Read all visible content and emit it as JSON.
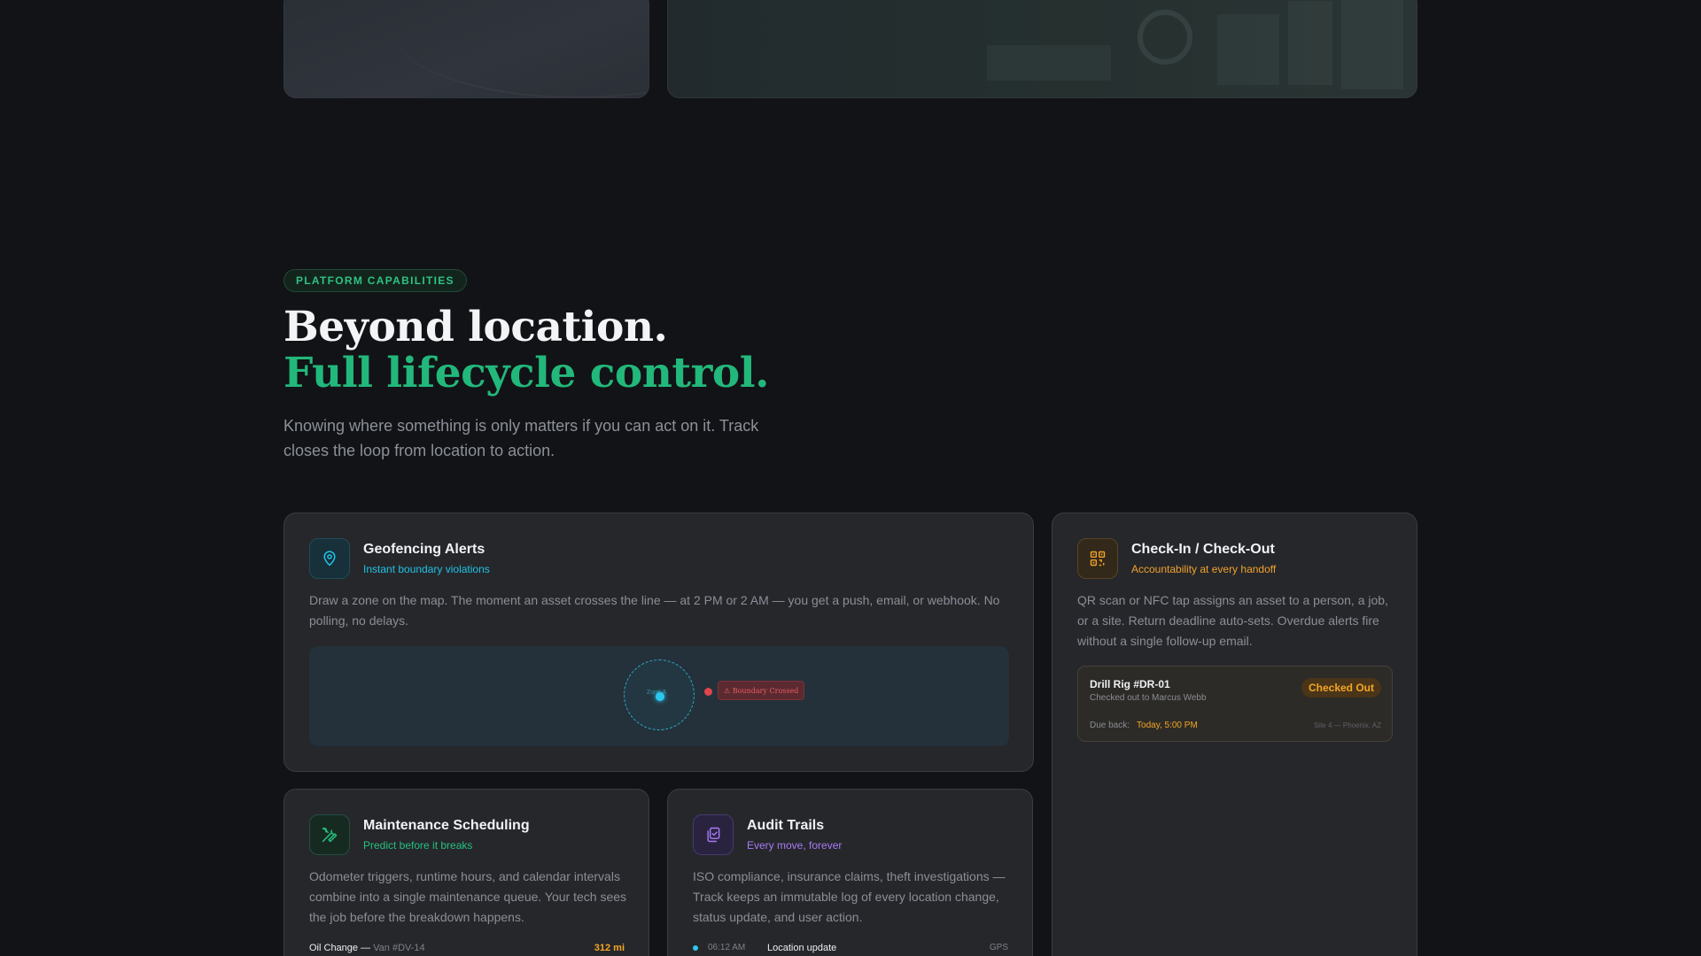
{
  "section": {
    "badge": "PLATFORM CAPABILITIES",
    "headline_line1": "Beyond location.",
    "headline_line2": "Full lifecycle control.",
    "intro": "Knowing where something is only matters if you can act on it. Track closes the loop from location to action."
  },
  "colors": {
    "background": "#121316",
    "card": "#26272b",
    "accent_green": "#22b87b",
    "accent_cyan": "#1fc3e4",
    "accent_amber": "#f5a623",
    "accent_purple": "#a77bf5",
    "alert_red": "#e0454b"
  },
  "cards": {
    "geofencing": {
      "icon": "map-pin-icon",
      "title": "Geofencing Alerts",
      "subtitle": "Instant boundary violations",
      "description": "Draw a zone on the map. The moment an asset crosses the line — at 2 PM or 2 AM — you get a push, email, or webhook. No polling, no delays.",
      "zone_label": "Zone A",
      "alert_label": "⚠ Boundary Crossed"
    },
    "checkin": {
      "icon": "qr-code-icon",
      "title": "Check-In / Check-Out",
      "subtitle": "Accountability at every handoff",
      "description": "QR scan or NFC tap assigns an asset to a person, a job, or a site. Return deadline auto-sets. Overdue alerts fire without a single follow-up email.",
      "ticket": {
        "asset": "Drill Rig #DR-01",
        "assignee": "Checked out to Marcus Webb",
        "status": "Checked Out",
        "due_label": "Due back:",
        "due_value": "Today, 5:00 PM",
        "site": "Site 4 — Phoenix, AZ"
      }
    },
    "maintenance": {
      "icon": "wrench-screwdriver-icon",
      "title": "Maintenance Scheduling",
      "subtitle": "Predict before it breaks",
      "description": "Odometer triggers, runtime hours, and calendar intervals combine into a single maintenance queue. Your tech sees the job before the breakdown happens.",
      "row": {
        "job": "Oil Change —",
        "vehicle": "Van #DV-14",
        "miles": "312 mi"
      }
    },
    "audit": {
      "icon": "clipboard-check-icon",
      "title": "Audit Trails",
      "subtitle": "Every move, forever",
      "description": "ISO compliance, insurance claims, theft investigations — Track keeps an immutable log of every location change, status update, and user action.",
      "row": {
        "time": "06:12 AM",
        "event": "Location update",
        "source": "GPS"
      }
    }
  }
}
